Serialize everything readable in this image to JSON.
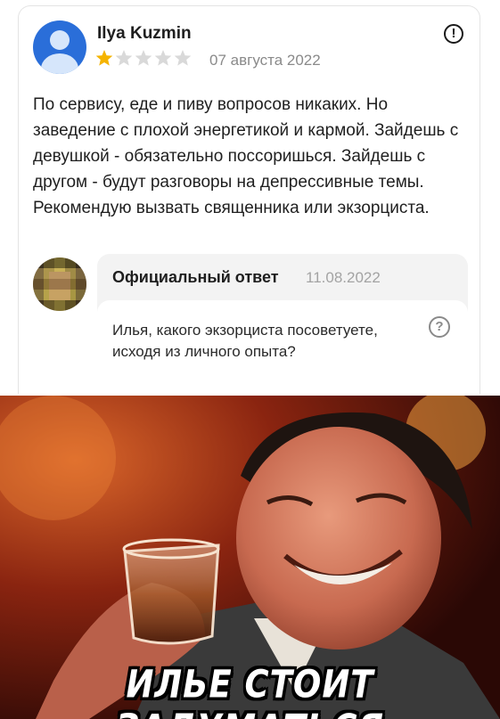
{
  "review": {
    "author": "Ilya Kuzmin",
    "rating": 1,
    "rating_max": 5,
    "date": "07 августа 2022",
    "text": "По сервису, еде и пиву вопросов никаких. Но заведение с плохой энергетикой и кармой. Зайдешь с девушкой - обязательно поссоришься. Зайдешь с другом - будут разговоры на депрессивные темы. Рекомендую вызвать священника или экзорциста.",
    "report_icon": "exclamation-circle-icon"
  },
  "official_reply": {
    "title": "Официальный ответ",
    "date": "11.08.2022",
    "text": "Илья, какого экзорциста посоветуете, исходя из личного опыта?",
    "help_icon": "question-circle-icon"
  },
  "meme": {
    "caption": "ИЛЬЕ СТОИТ ЗАДУМАТЬСЯ"
  },
  "colors": {
    "star_filled": "#f5b400",
    "star_empty": "#d9d9d9",
    "avatar_bg": "#2a6ed9",
    "reply_bg": "#f3f3f3"
  }
}
